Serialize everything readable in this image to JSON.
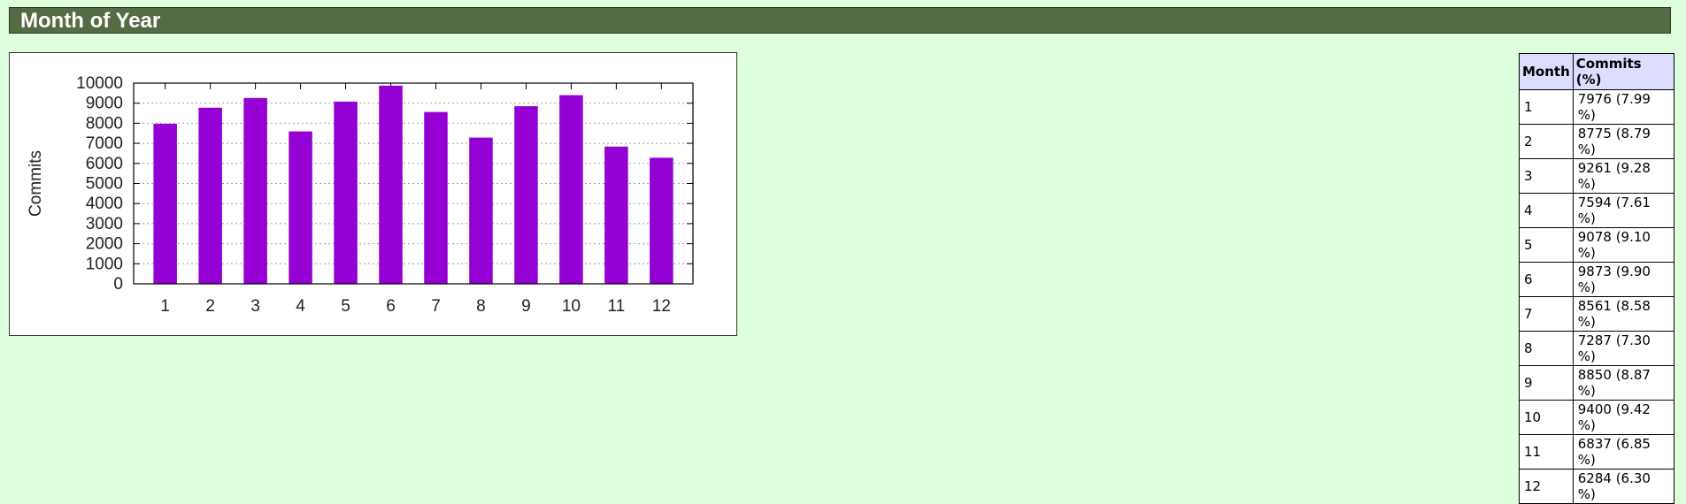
{
  "section": {
    "title": "Month of Year"
  },
  "colors": {
    "bar": "#9400d3",
    "header_bg": "#556b44",
    "page_bg": "#ddffdd",
    "table_header_bg": "#ddddff"
  },
  "chart_data": {
    "type": "bar",
    "categories": [
      "1",
      "2",
      "3",
      "4",
      "5",
      "6",
      "7",
      "8",
      "9",
      "10",
      "11",
      "12"
    ],
    "values": [
      7976,
      8775,
      9261,
      7594,
      9078,
      9873,
      8561,
      7287,
      8850,
      9400,
      6837,
      6284
    ],
    "ylabel": "Commits",
    "ylim": [
      0,
      10000
    ],
    "yticks": [
      0,
      1000,
      2000,
      3000,
      4000,
      5000,
      6000,
      7000,
      8000,
      9000,
      10000
    ],
    "grid": true,
    "legend": "none"
  },
  "table": {
    "headers": [
      "Month",
      "Commits (%)"
    ],
    "rows": [
      [
        "1",
        "7976 (7.99 %)"
      ],
      [
        "2",
        "8775 (8.79 %)"
      ],
      [
        "3",
        "9261 (9.28 %)"
      ],
      [
        "4",
        "7594 (7.61 %)"
      ],
      [
        "5",
        "9078 (9.10 %)"
      ],
      [
        "6",
        "9873 (9.90 %)"
      ],
      [
        "7",
        "8561 (8.58 %)"
      ],
      [
        "8",
        "7287 (7.30 %)"
      ],
      [
        "9",
        "8850 (8.87 %)"
      ],
      [
        "10",
        "9400 (9.42 %)"
      ],
      [
        "11",
        "6837 (6.85 %)"
      ],
      [
        "12",
        "6284 (6.30 %)"
      ]
    ]
  }
}
